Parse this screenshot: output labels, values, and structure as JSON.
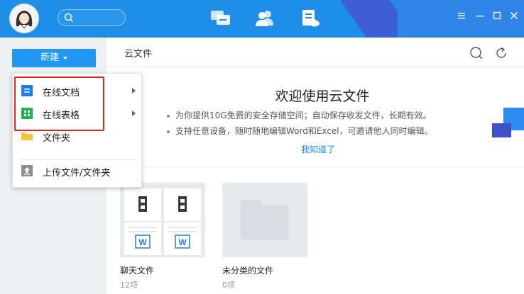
{
  "topbar": {
    "search_placeholder": "",
    "nav": [
      {
        "name": "messages-nav-icon"
      },
      {
        "name": "contacts-nav-icon"
      },
      {
        "name": "cloud-files-nav-icon",
        "active": true
      }
    ],
    "window_controls": [
      "menu-icon",
      "minimize-icon",
      "maximize-icon",
      "close-icon"
    ]
  },
  "sidebar": {
    "new_button_label": "新建"
  },
  "header": {
    "title": "云文件",
    "icons": [
      "search-icon",
      "refresh-icon"
    ]
  },
  "welcome": {
    "title": "欢迎使用云文件",
    "bullets": [
      "为你提供10G免费的安全存储空间；自动保存收发文件，长期有效。",
      "支持任意设备，随时随地编辑Word和Excel，可邀请他人同时编辑。"
    ],
    "link_label": "我知道了"
  },
  "folders": [
    {
      "name": "聊天文件",
      "count": "12项"
    },
    {
      "name": "未分类的文件",
      "count": "0项"
    }
  ],
  "dropdown": {
    "items": [
      {
        "label": "在线文档",
        "icon": "online-doc-icon",
        "color": "#1e7be8",
        "has_submenu": true
      },
      {
        "label": "在线表格",
        "icon": "online-sheet-icon",
        "color": "#22b14c",
        "has_submenu": true
      },
      {
        "label": "文件夹",
        "icon": "folder-icon",
        "color": "#f5c342",
        "has_submenu": false
      },
      {
        "label": "上传文件/文件夹",
        "icon": "upload-icon",
        "color": "#8c8c8c",
        "has_submenu": false
      }
    ]
  },
  "colors": {
    "titlebar": "#1f8ee8",
    "accent": "#2196f3",
    "link": "#1c86e0",
    "highlight": "#e0281e"
  }
}
